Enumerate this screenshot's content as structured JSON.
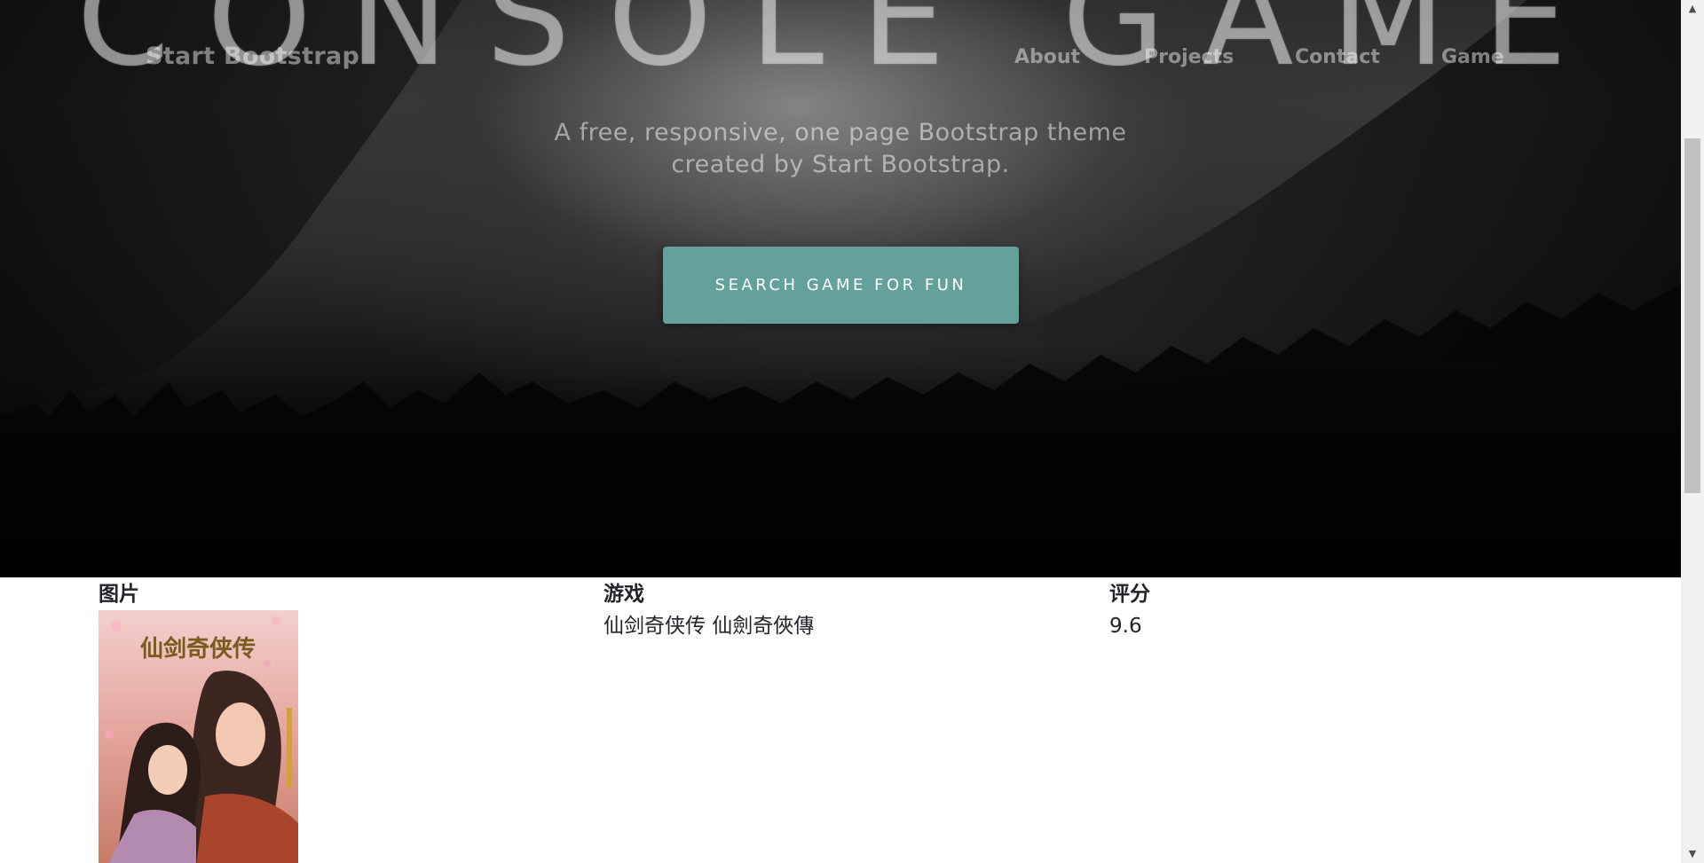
{
  "hero": {
    "title": "CONSOLE GAME",
    "subtitle_line1": "A free, responsive, one page Bootstrap theme",
    "subtitle_line2": "created by Start Bootstrap.",
    "cta_label": "SEARCH GAME FOR FUN"
  },
  "navbar": {
    "brand": "Start Bootstrap",
    "links": [
      "About",
      "Projects",
      "Contact",
      "Game"
    ]
  },
  "table": {
    "headers": [
      "图片",
      "游戏",
      "评分"
    ],
    "rows": [
      {
        "game": "仙剑奇侠传 仙劍奇俠傳",
        "rating": "9.6",
        "cover_title": "仙剑奇侠传"
      }
    ]
  },
  "colors": {
    "accent": "#64a19d",
    "text": "#212529"
  },
  "scrollbar": {
    "up_icon": "triangle-up-icon",
    "down_icon": "triangle-down-icon"
  }
}
